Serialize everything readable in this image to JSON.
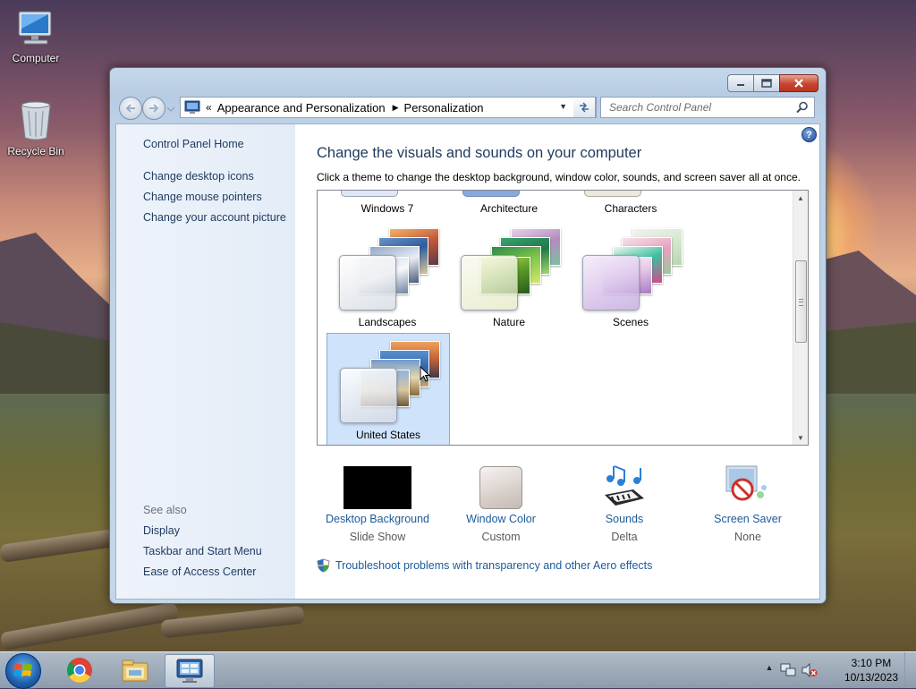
{
  "desktop": {
    "icons": [
      {
        "label": "Computer"
      },
      {
        "label": "Recycle Bin"
      }
    ]
  },
  "window": {
    "caption_buttons": [
      "minimize",
      "maximize",
      "close"
    ],
    "address": {
      "overflow": "«",
      "crumbs": [
        "Appearance and Personalization",
        "Personalization"
      ]
    },
    "search": {
      "placeholder": "Search Control Panel"
    },
    "sidebar": {
      "home": "Control Panel Home",
      "links": [
        "Change desktop icons",
        "Change mouse pointers",
        "Change your account picture"
      ],
      "see_also_label": "See also",
      "see_also": [
        "Display",
        "Taskbar and Start Menu",
        "Ease of Access Center"
      ]
    },
    "main": {
      "title": "Change the visuals and sounds on your computer",
      "subtitle": "Click a theme to change the desktop background, window color, sounds, and screen saver all at once.",
      "themes": [
        {
          "label": "Windows 7"
        },
        {
          "label": "Architecture"
        },
        {
          "label": "Characters"
        },
        {
          "label": "Landscapes"
        },
        {
          "label": "Nature"
        },
        {
          "label": "Scenes"
        },
        {
          "label": "United States",
          "selected": true
        }
      ],
      "settings": [
        {
          "title": "Desktop Background",
          "value": "Slide Show"
        },
        {
          "title": "Window Color",
          "value": "Custom"
        },
        {
          "title": "Sounds",
          "value": "Delta"
        },
        {
          "title": "Screen Saver",
          "value": "None"
        }
      ],
      "troubleshoot": "Troubleshoot problems with transparency and other Aero effects"
    }
  },
  "taskbar": {
    "items": [
      "chrome-icon",
      "explorer-icon",
      "control-panel-icon"
    ],
    "clock": {
      "time": "3:10 PM",
      "date": "10/13/2023"
    }
  },
  "colors": {
    "link": "#1e5a99",
    "heading": "#1e3a5f",
    "selection": "#cfe3fa"
  }
}
